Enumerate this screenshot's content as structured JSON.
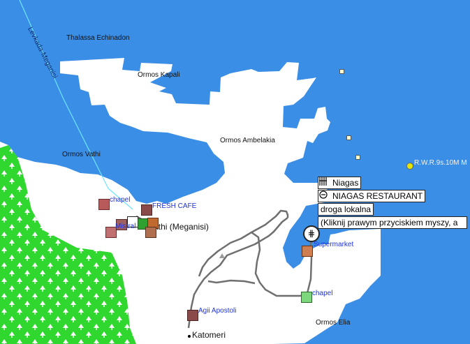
{
  "map": {
    "colors": {
      "water": "#3a8ee6",
      "land": "#ffffff",
      "forest": "#2fd72f",
      "road": "#6f6f6f",
      "ferry_route": "#6ee6ff",
      "poi_label": "#1f33d8"
    },
    "labels": {
      "thalassa": "Thalassa Echinadon",
      "kapali": "Ormos Kapali",
      "ambelakia": "Ormos Ambelakia",
      "ormos_vathi": "Ormos Vathi",
      "strait": "Levkada-Meganisi",
      "town": "Vathi (Meganisi)",
      "katomeri": "Katomeri",
      "ormos_elia": "Ormos Elia",
      "marker": "R.W.R.9s.10M M"
    },
    "pois": {
      "chapel_west": "chapel",
      "fresh_cafe": "FRESH CAFE",
      "mistral": "Mistral",
      "supermarket": "Supermarket",
      "chapel_east": "chapel",
      "agii_apostoli": "Agii Apostoli"
    },
    "tooltip": {
      "icon": "restaurant-fork-knife-icon",
      "line1": "Niagas",
      "line2": "NIAGAS RESTAURANT",
      "line3": "droga lokalna",
      "line4": "(Kliknij prawym przyciskiem myszy, a",
      "hidden_line": "NIAGAS RESTAURANT"
    }
  }
}
